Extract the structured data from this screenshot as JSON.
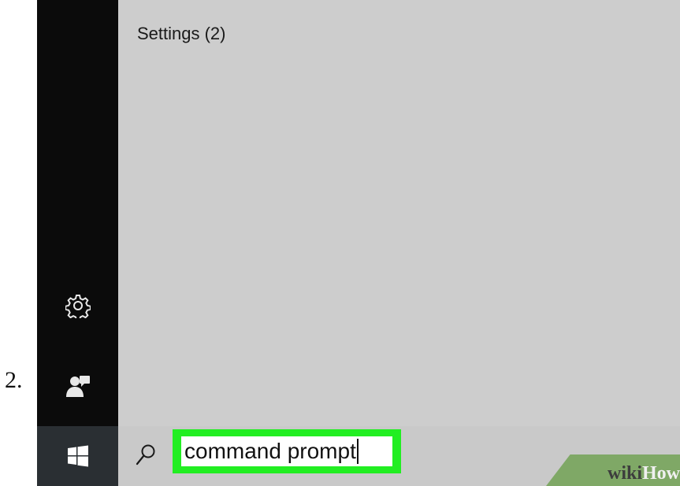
{
  "step": {
    "number": "2."
  },
  "results": {
    "group_header": "Settings (2)"
  },
  "search": {
    "value": "command prompt"
  },
  "icons": {
    "settings": "gear-icon",
    "account": "user-account-icon",
    "start": "windows-logo-icon",
    "search": "search-icon"
  },
  "watermark": {
    "part1": "wiki",
    "part2": "How"
  },
  "colors": {
    "highlight": "#22ee22",
    "rail": "#0b0b0b",
    "panel": "#cdcdcd",
    "start_button": "#2a2f33",
    "watermark_bg": "#7fa866"
  }
}
